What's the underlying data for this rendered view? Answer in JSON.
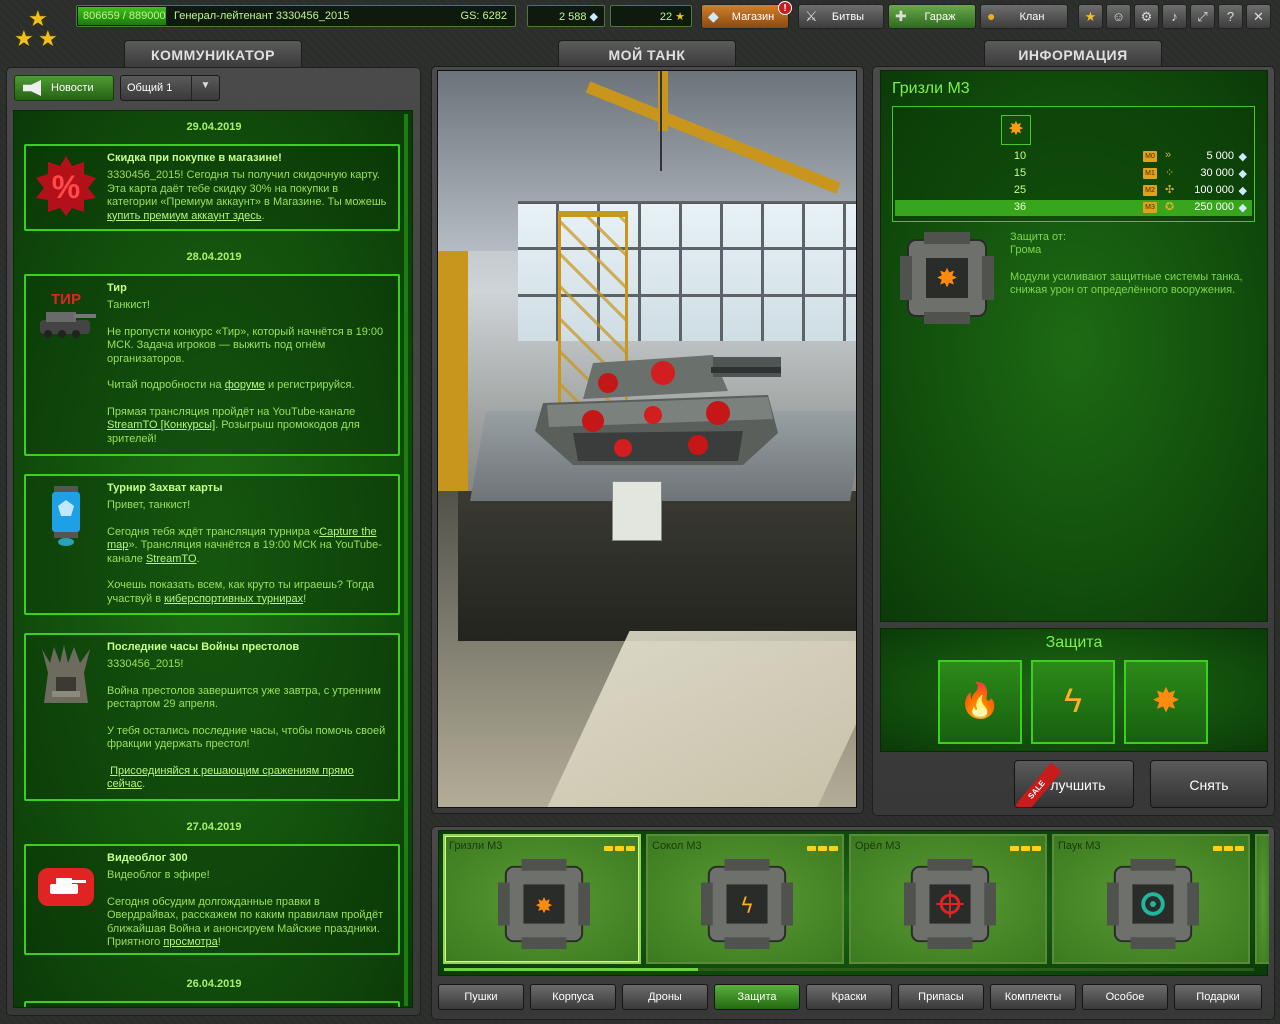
{
  "topbar": {
    "xp": "806659 / 889000",
    "rank_name": "Генерал-лейтенант 3330456_2015",
    "gs": "GS: 6282",
    "crystals": "2 588",
    "stars": "22",
    "nav": [
      {
        "label": "Магазин"
      },
      {
        "label": "Битвы"
      },
      {
        "label": "Гараж"
      },
      {
        "label": "Клан"
      }
    ],
    "shop_badge": "!",
    "help": "?"
  },
  "tabs": {
    "communicator": "КОММУНИКАТОР",
    "my_tank": "МОЙ ТАНК",
    "info": "ИНФОРМАЦИЯ"
  },
  "communicator": {
    "news_button": "Новости",
    "channel": "Общий 1",
    "dates": [
      "29.04.2019",
      "28.04.2019",
      "27.04.2019",
      "26.04.2019"
    ],
    "news": [
      {
        "title": "Скидка при покупке в магазине!",
        "body1": "3330456_2015! Сегодня ты получил скидочную карту. Эта карта даёт тебе скидку 30% на покупки в категории «Премиум аккаунт» в Магазине. Ты можешь ",
        "link1": "купить премиум аккаунт здесь",
        "tail1": "."
      },
      {
        "title": "Тир",
        "icon_text": "ТИР",
        "p1": "Танкист!",
        "p2": "Не пропусти конкурс «Тир», который начнётся в 19:00 МСК. Задача игроков — выжить под огнём организаторов.",
        "p3a": "Читай подробности на ",
        "p3link": "форуме",
        "p3b": " и регистрируйся.",
        "p4a": "Прямая трансляция пройдёт на YouTube-канале ",
        "p4link": "StreamTO [Конкурсы]",
        "p4b": ". Розыгрыш промокодов для зрителей!"
      },
      {
        "title": "Турнир Захват карты",
        "p1": "Привет, танкист!",
        "p2a": " Сегодня тебя ждёт трансляция турнира  «",
        "p2link": "Capture the map",
        "p2b": "». Трансляция начнётся в 19:00 МСК на YouTube-канале  ",
        "p2link2": "StreamTO",
        "p2c": ".",
        "p3a": "Хочешь показать всем, как круто ты играешь? Тогда участвуй в  ",
        "p3link": "киберспортивных турнирах",
        "p3b": "!"
      },
      {
        "title": "Последние часы Войны престолов",
        "p1": "3330456_2015!",
        "p2": "Война престолов завершится уже завтра, с утренним рестартом 29 апреля.",
        "p3": "У тебя остались последние часы, чтобы помочь своей фракции удержать престол!",
        "p4link": "Присоединяйся к решающим сражениям прямо сейчас",
        "p4b": "."
      },
      {
        "title": "Видеоблог 300",
        "p1": "Видеоблог в эфире!",
        "p2a": "Сегодня обсудим долгожданные правки в Овердрайвах, расскажем по каким правилам пройдёт ближайшая Война и анонсируем Майские праздники. Приятного  ",
        "p2link": "просмотра",
        "p2b": "!"
      }
    ]
  },
  "info": {
    "item_name": "Гризли М3",
    "rows": [
      {
        "level": "10",
        "mark": "M0",
        "price": "5 000"
      },
      {
        "level": "15",
        "mark": "M1",
        "price": "30 000"
      },
      {
        "level": "25",
        "mark": "M2",
        "price": "100 000"
      },
      {
        "level": "36",
        "mark": "M3",
        "price": "250 000"
      }
    ],
    "protection_from_label": "Защита от:",
    "protection_from_value": "Грома",
    "description": "Модули усиливают защитные системы танка, снижая урон от определённого вооружения.",
    "defense_title": "Защита",
    "upgrade_button": "Улучшить",
    "sale_label": "SALE",
    "remove_button": "Снять"
  },
  "modules": [
    {
      "name": "Гризли М3"
    },
    {
      "name": "Сокол М3"
    },
    {
      "name": "Орёл М3"
    },
    {
      "name": "Паук М3"
    }
  ],
  "categories": [
    "Пушки",
    "Корпуса",
    "Дроны",
    "Защита",
    "Краски",
    "Припасы",
    "Комплекты",
    "Особое",
    "Подарки"
  ],
  "active_category": "Защита",
  "colors": {
    "accent_green": "#3cd01e",
    "panel_green": "#104a0b",
    "text_green": "#9be15a",
    "star_gold": "#f0c020"
  }
}
